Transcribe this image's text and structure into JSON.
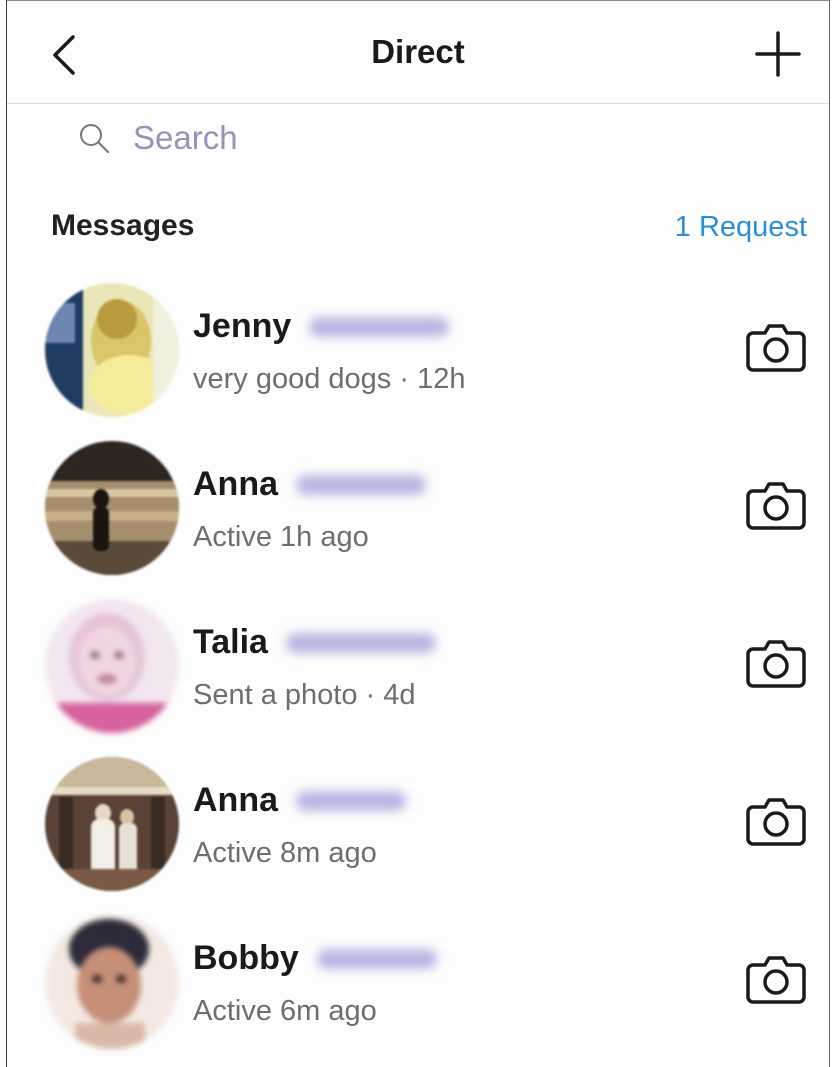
{
  "header": {
    "title": "Direct"
  },
  "search": {
    "placeholder": "Search"
  },
  "section": {
    "title": "Messages",
    "requests_label": "1 Request"
  },
  "colors": {
    "accent_link": "#2b8fd6",
    "search_placeholder": "#9a90b8",
    "blurred_surname": "#b7b7e2"
  },
  "conversations": [
    {
      "name": "Jenny",
      "subtitle": "very good dogs · 12h"
    },
    {
      "name": "Anna",
      "subtitle": "Active 1h ago"
    },
    {
      "name": "Talia",
      "subtitle": "Sent a photo · 4d"
    },
    {
      "name": "Anna",
      "subtitle": "Active 8m ago"
    },
    {
      "name": "Bobby",
      "subtitle": "Active 6m ago"
    }
  ]
}
